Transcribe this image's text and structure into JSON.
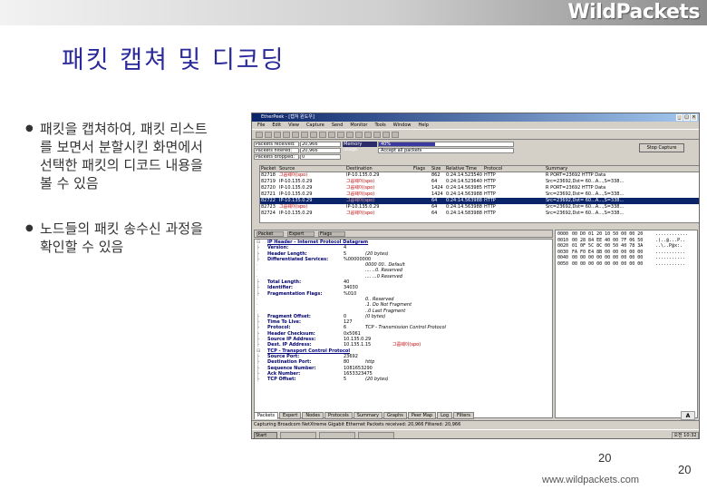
{
  "slide": {
    "logo": "WildPackets",
    "title": "패킷 캡쳐 및 디코딩",
    "bullets": [
      "패킷을 캡쳐하여, 패킷 리스트\n를 보면서 분할시킨 화면에서\n선택한 패킷의 디코드 내용을\n볼 수 있음",
      "노드들의 패킷 송수신 과정을\n확인할 수 있음"
    ],
    "page_center": "20",
    "page_right": "20",
    "url": "www.wildpackets.com"
  },
  "app": {
    "title": "EtherPeek - [캡쳐 윈도우]",
    "menu": [
      "File",
      "Edit",
      "View",
      "Capture",
      "Send",
      "Monitor",
      "Tools",
      "Window",
      "Help"
    ],
    "stats": [
      [
        "Packets received:",
        "20,966"
      ],
      [
        "Packets filtered:",
        "20,966"
      ],
      [
        "Packets dropped:",
        "0"
      ]
    ],
    "memory_label": "Memory usage:",
    "memory_pct": "40%",
    "memory_level": 0.42,
    "filter_text": "Accept all packets",
    "stop_button": "Stop Capture",
    "packet_columns": [
      "Packet",
      "Source",
      "Destination",
      "Flags",
      "Size",
      "Relative Time",
      "Protocol",
      "Summary"
    ],
    "packets": [
      [
        "82718",
        "그룹웨이(spo)",
        "IP-10.135.0.29",
        "",
        "862",
        "0:24:14.523540",
        "HTTP",
        "R PORT=23692 HTTP Data"
      ],
      [
        "82719",
        "IP-10.135.0.29",
        "그룹웨이(spo)",
        "",
        "64",
        "0:24:14.523640",
        "HTTP",
        "Src=23692,Dst=   60...A...,S=338..."
      ],
      [
        "82720",
        "IP-10.135.0.29",
        "그룹웨이(spo)",
        "",
        "1424",
        "0:24:14.563985",
        "HTTP",
        "R PORT=23692 HTTP Data"
      ],
      [
        "82721",
        "IP-10.135.0.29",
        "그룹웨이(spo)",
        "",
        "1424",
        "0:24:14.563988",
        "HTTP",
        "Src=23692,Dst=   60...A...,S=338..."
      ],
      [
        "82722",
        "IP-10.135.0.29",
        "그룹웨이(spo)",
        "",
        "64",
        "0:24:14.563988",
        "HTTP",
        "Src=23692,Dst=   60...A...,S=338..."
      ],
      [
        "82723",
        "그룹웨이(spo)",
        "IP-10.135.0.29",
        "",
        "64",
        "0:24:14.563988",
        "HTTP",
        "Src=23692,Dst=   60...A...,S=338..."
      ],
      [
        "82724",
        "IP-10.135.0.29",
        "그룹웨이(spo)",
        "",
        "64",
        "0:24:14.583988",
        "HTTP",
        "Src=23692,Dst=   60...A...,S=338..."
      ]
    ],
    "selected_packet": 4,
    "decode_header": [
      "Packet",
      "Expert",
      "Flags"
    ],
    "decode": [
      {
        "t": "hdr",
        "l": "IP Header - Internet Protocol Datagram",
        "v": "",
        "a": ""
      },
      {
        "t": "f",
        "l": "Version:",
        "v": "4",
        "a": ""
      },
      {
        "t": "f",
        "l": "Header Length:",
        "v": "5",
        "a": "(20 bytes)"
      },
      {
        "t": "f",
        "l": "Differentiated Services:",
        "v": "%00000000",
        "a": ""
      },
      {
        "t": "s",
        "l": "",
        "v": "",
        "a": "0000 00.. Default"
      },
      {
        "t": "s",
        "l": "",
        "v": "",
        "a": ".... ..0. Reserved"
      },
      {
        "t": "s",
        "l": "",
        "v": "",
        "a": ".... ...0 Reserved"
      },
      {
        "t": "f",
        "l": "Total Length:",
        "v": "40",
        "a": ""
      },
      {
        "t": "f",
        "l": "Identifier:",
        "v": "34030",
        "a": ""
      },
      {
        "t": "f",
        "l": "Fragmentation Flags:",
        "v": "%010",
        "a": ""
      },
      {
        "t": "s",
        "l": "",
        "v": "",
        "a": "0.. Reserved"
      },
      {
        "t": "s",
        "l": "",
        "v": "",
        "a": ".1. Do Not Fragment"
      },
      {
        "t": "s",
        "l": "",
        "v": "",
        "a": "..0 Last Fragment"
      },
      {
        "t": "f",
        "l": "Fragment Offset:",
        "v": "0",
        "a": "(0 bytes)"
      },
      {
        "t": "f",
        "l": "Time To Live:",
        "v": "127",
        "a": ""
      },
      {
        "t": "f",
        "l": "Protocol:",
        "v": "6",
        "a": "TCP - Transmission Control Protocol"
      },
      {
        "t": "f",
        "l": "Header Checksum:",
        "v": "0x5061",
        "a": ""
      },
      {
        "t": "f",
        "l": "Source IP Address:",
        "v": "10.135.0.29",
        "a": ""
      },
      {
        "t": "f",
        "l": "Dest. IP Address:",
        "v": "10.135.1.15",
        "a": "",
        "red": "그룹웨이(spo)"
      },
      {
        "t": "hdr",
        "l": "TCP - Transport Control Protocol",
        "v": "",
        "a": ""
      },
      {
        "t": "f",
        "l": "Source Port:",
        "v": "23692",
        "a": ""
      },
      {
        "t": "f",
        "l": "Destination Port:",
        "v": "80",
        "a": "http"
      },
      {
        "t": "f",
        "l": "Sequence Number:",
        "v": "1081653290",
        "a": ""
      },
      {
        "t": "f",
        "l": "Ack Number:",
        "v": "1653323475",
        "a": ""
      },
      {
        "t": "f",
        "l": "TCP Offset:",
        "v": "5",
        "a": "(20 bytes)"
      }
    ],
    "hex": [
      [
        "0000",
        "00 D0 01 20 10 50 00 00 20",
        "............"
      ],
      [
        "0010",
        "00 28 84 EE 40 00 7F 06 50",
        ".(..@...P.."
      ],
      [
        "0020",
        "01 0F 5C 8C 00 50 40 78 3A",
        "..\\..P@x:."
      ],
      [
        "0030",
        "FA F0 E4 8B 00 00 00 00 00",
        "..........."
      ],
      [
        "0040",
        "00 00 00 00 00 00 00 00 00",
        "..........."
      ],
      [
        "0050",
        "00 00 00 00 00 00 00 00 00",
        "..........."
      ]
    ],
    "tabs": [
      "Packets",
      "Expert",
      "Nodes",
      "Protocols",
      "Summary",
      "Graphs",
      "Peer Map",
      "Log",
      "Filters"
    ],
    "status": "Capturing    Broadcom NetXtreme Gigabit Ethernet    Packets received: 20,966    Filtered: 20,966",
    "taskbar_start": "Start",
    "clock": "오전 10:32",
    "badge": "A"
  }
}
